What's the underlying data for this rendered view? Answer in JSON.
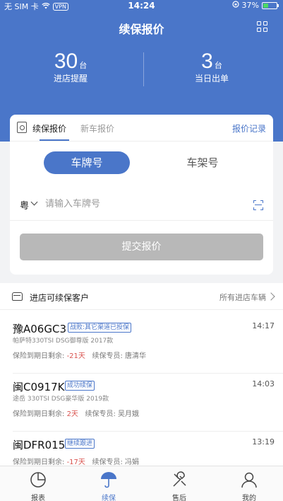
{
  "status_bar": {
    "carrier": "无 SIM 卡",
    "vpn": "VPN",
    "time": "14:24",
    "battery": "37%",
    "battery_level": 0.37
  },
  "header": {
    "title": "续保报价",
    "menu_icon": "grid-icon"
  },
  "stats": [
    {
      "value": "30",
      "unit": "台",
      "label": "进店提醒"
    },
    {
      "value": "3",
      "unit": "台",
      "label": "当日出单"
    }
  ],
  "quote_card": {
    "tabs": [
      "续保报价",
      "新车报价"
    ],
    "active_tab": "续保报价",
    "history_link": "报价记录",
    "segments": [
      "车牌号",
      "车架号"
    ],
    "active_segment": "车牌号",
    "province": "粤",
    "plate_placeholder": "请输入车牌号",
    "submit_label": "提交报价"
  },
  "customer_list": {
    "title": "进店可续保客户",
    "link": "所有进店车辆",
    "items": [
      {
        "plate": "豫A06GC3",
        "badge": "战败:其它渠道已投保",
        "time": "14:17",
        "model": "帕萨特330TSI DSG御尊版 2017款",
        "days_prefix": "保险到期日剩余: ",
        "days": "-21天",
        "specialist": "续保专员: 唐清华"
      },
      {
        "plate": "闽C0917K",
        "badge": "成功续保",
        "time": "14:03",
        "model": "途岳 330TSI DSG豪华版 2019款",
        "days_prefix": "保险到期日剩余: ",
        "days": "2天",
        "specialist": "续保专员: 吴月娥"
      },
      {
        "plate": "闽DFR015",
        "badge": "继续跟进",
        "time": "13:19",
        "model": "",
        "days_prefix": "保险到期日剩余: ",
        "days": "-17天",
        "specialist": "续保专员: 冯娟"
      }
    ]
  },
  "tabbar": [
    {
      "label": "报表",
      "icon": "pie-chart-icon"
    },
    {
      "label": "续保",
      "icon": "umbrella-icon",
      "active": true
    },
    {
      "label": "售后",
      "icon": "wrench-icon"
    },
    {
      "label": "我的",
      "icon": "user-icon"
    }
  ],
  "colors": {
    "primary": "#4a76c9",
    "negative": "#d9534f",
    "disabled_button": "#b8b8b8",
    "battery": "#4cd964"
  }
}
